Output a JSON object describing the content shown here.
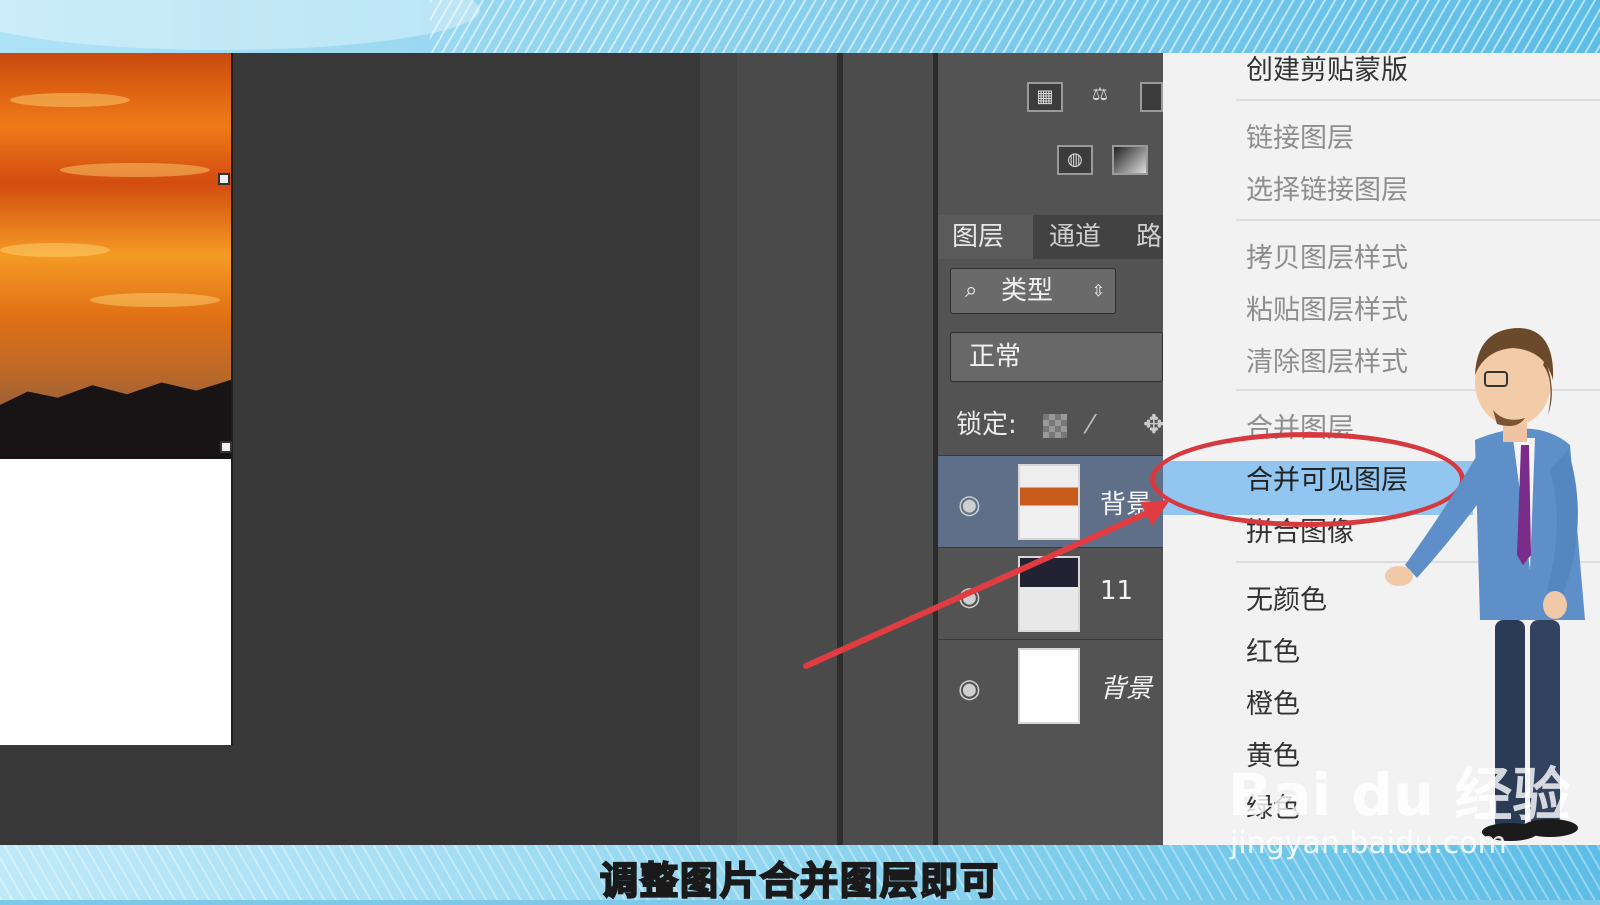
{
  "colors": {
    "workspace": "#383838",
    "panel": "#535353",
    "menu": "#f2f2f2",
    "highlight": "#92c6f0",
    "annotation_red": "#d63a3f",
    "subtitle_yellow": "#f7e600"
  },
  "panel": {
    "tabs": [
      {
        "label": "图层",
        "active": true
      },
      {
        "label": "通道",
        "active": false
      },
      {
        "label": "路",
        "active": false
      }
    ],
    "filter_label": "类型",
    "blend_mode": "正常",
    "lock_label": "锁定:",
    "layers": [
      {
        "name": "背景",
        "selected": true
      },
      {
        "name": "11",
        "selected": false
      },
      {
        "name": "背景",
        "selected": false
      }
    ]
  },
  "context_menu": {
    "items": [
      {
        "label": "创建剪贴蒙版",
        "enabled": true
      },
      {
        "label": "链接图层",
        "enabled": false
      },
      {
        "label": "选择链接图层",
        "enabled": false
      },
      {
        "label": "拷贝图层样式",
        "enabled": false
      },
      {
        "label": "粘贴图层样式",
        "enabled": false
      },
      {
        "label": "清除图层样式",
        "enabled": false
      },
      {
        "label": "合并图层",
        "enabled": false
      },
      {
        "label": "合并可见图层",
        "enabled": true,
        "highlighted": true
      },
      {
        "label": "拼合图像",
        "enabled": true
      },
      {
        "label": "无颜色",
        "enabled": true
      },
      {
        "label": "红色",
        "enabled": true
      },
      {
        "label": "橙色",
        "enabled": true
      },
      {
        "label": "黄色",
        "enabled": true
      },
      {
        "label": "绿色",
        "enabled": true
      }
    ]
  },
  "subtitle": "调整图片合并图层即可",
  "watermark": {
    "logo": "Bai du 经验",
    "url": "jingyan.baidu.com"
  },
  "icons": [
    "histogram-icon",
    "balance-icon",
    "crop-icon",
    "camera-icon",
    "gradient-icon",
    "eye-icon",
    "search-icon",
    "updown-arrow-icon",
    "checker-lock-icon",
    "brush-lock-icon",
    "move-lock-icon"
  ]
}
